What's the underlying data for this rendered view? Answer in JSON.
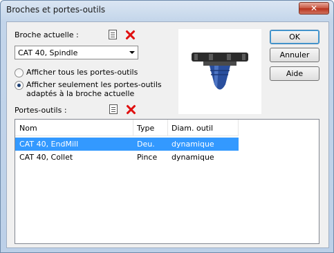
{
  "window": {
    "title": "Broches et portes-outils",
    "close_glyph": "✕"
  },
  "spindle": {
    "label": "Broche actuelle :",
    "selected": "CAT 40, Spindle"
  },
  "options": [
    {
      "label": "Afficher tous les portes-outils",
      "selected": false
    },
    {
      "label_line1": "Afficher seulement les portes-outils",
      "label_line2": "adaptés à la broche actuelle",
      "selected": true
    }
  ],
  "holders": {
    "label": "Portes-outils :",
    "columns": [
      "Nom",
      "Type",
      "Diam. outil"
    ],
    "rows": [
      {
        "name": "CAT 40, EndMill",
        "type": "Deu.",
        "diam": "dynamique",
        "selected": true
      },
      {
        "name": "CAT 40, Collet",
        "type": "Pince",
        "diam": "dynamique",
        "selected": false
      }
    ]
  },
  "buttons": {
    "ok": "OK",
    "cancel": "Annuler",
    "help": "Aide"
  },
  "icons": {
    "list": "list-document-icon",
    "delete": "red-x-delete-icon"
  },
  "colors": {
    "selection": "#3399ff",
    "delete_red": "#e01010",
    "holder_body": "#2a4f9e"
  }
}
